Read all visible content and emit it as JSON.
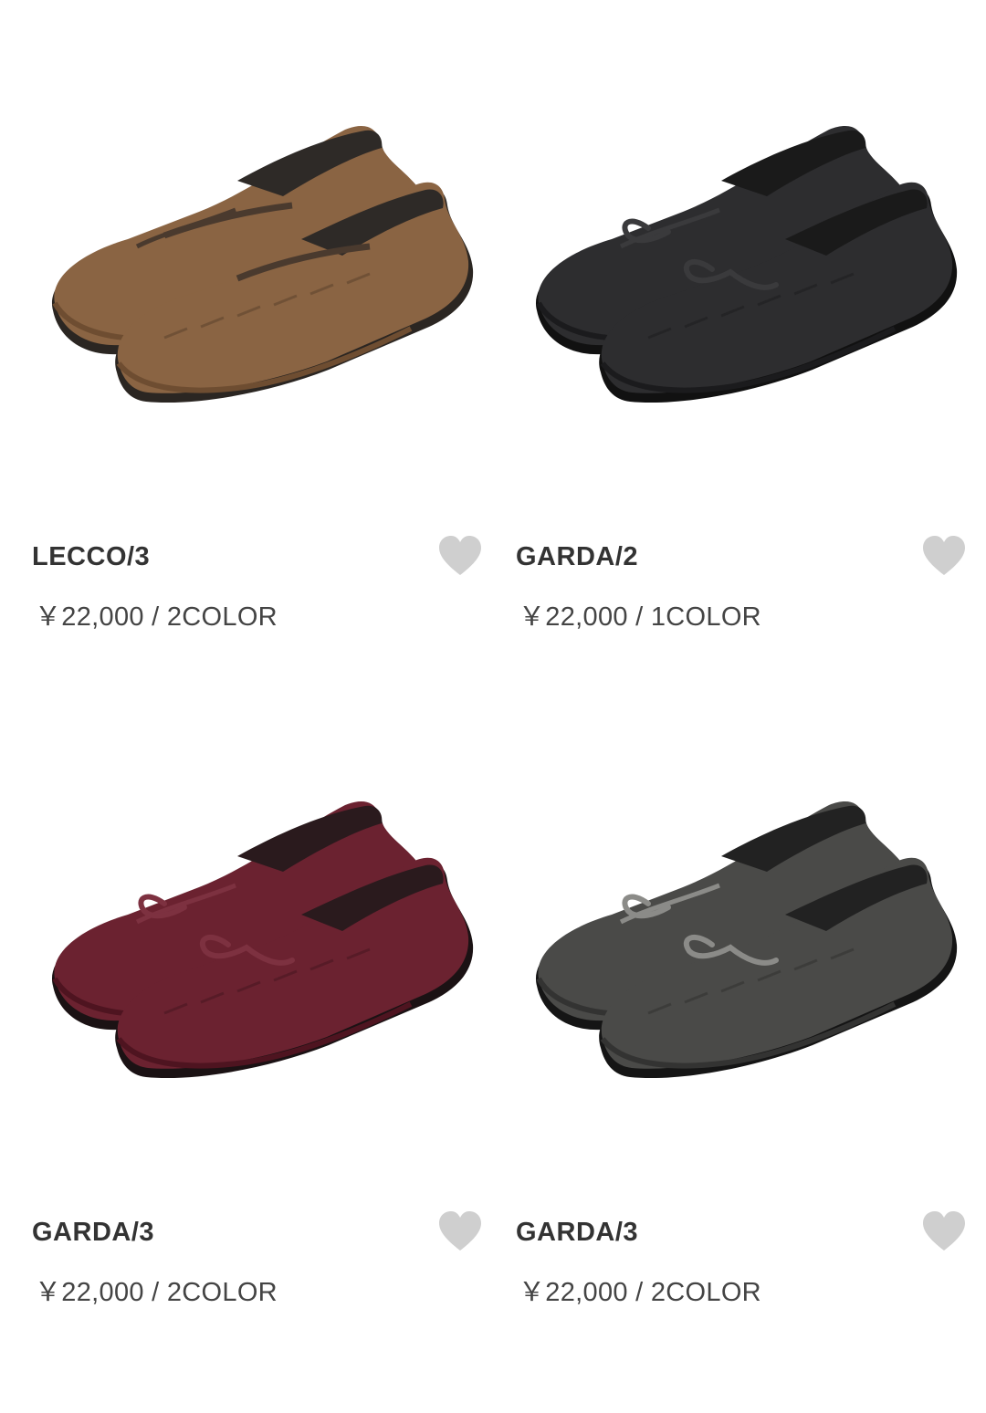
{
  "products": [
    {
      "name": "LECCO/3",
      "price": "￥22,000 / 2COLOR",
      "image_icon": "suede-driving-loafer",
      "colors": {
        "upper": "#8a6443",
        "shade": "#6e4d31",
        "sole": "#2b2622",
        "inner": "#2e2a27",
        "accent": "#4a3a2e"
      }
    },
    {
      "name": "GARDA/2",
      "price": "￥22,000 / 1COLOR",
      "image_icon": "black-croc-loafer",
      "colors": {
        "upper": "#2d2d2f",
        "shade": "#1b1b1d",
        "sole": "#111111",
        "inner": "#1a1a1a",
        "accent": "#3a3a3c"
      }
    },
    {
      "name": "GARDA/3",
      "price": "￥22,000 / 2COLOR",
      "image_icon": "burgundy-woven-loafer",
      "colors": {
        "upper": "#6b2230",
        "shade": "#4e1420",
        "sole": "#1b1214",
        "inner": "#2a1a1d",
        "accent": "#7d3140"
      }
    },
    {
      "name": "GARDA/3",
      "price": "￥22,000 / 2COLOR",
      "image_icon": "grey-woven-loafer",
      "colors": {
        "upper": "#4a4a48",
        "shade": "#333332",
        "sole": "#151515",
        "inner": "#222222",
        "accent": "#8b8b88"
      }
    }
  ],
  "favorite_icon": "heart-icon",
  "favorite_color": "#cfcfcf"
}
